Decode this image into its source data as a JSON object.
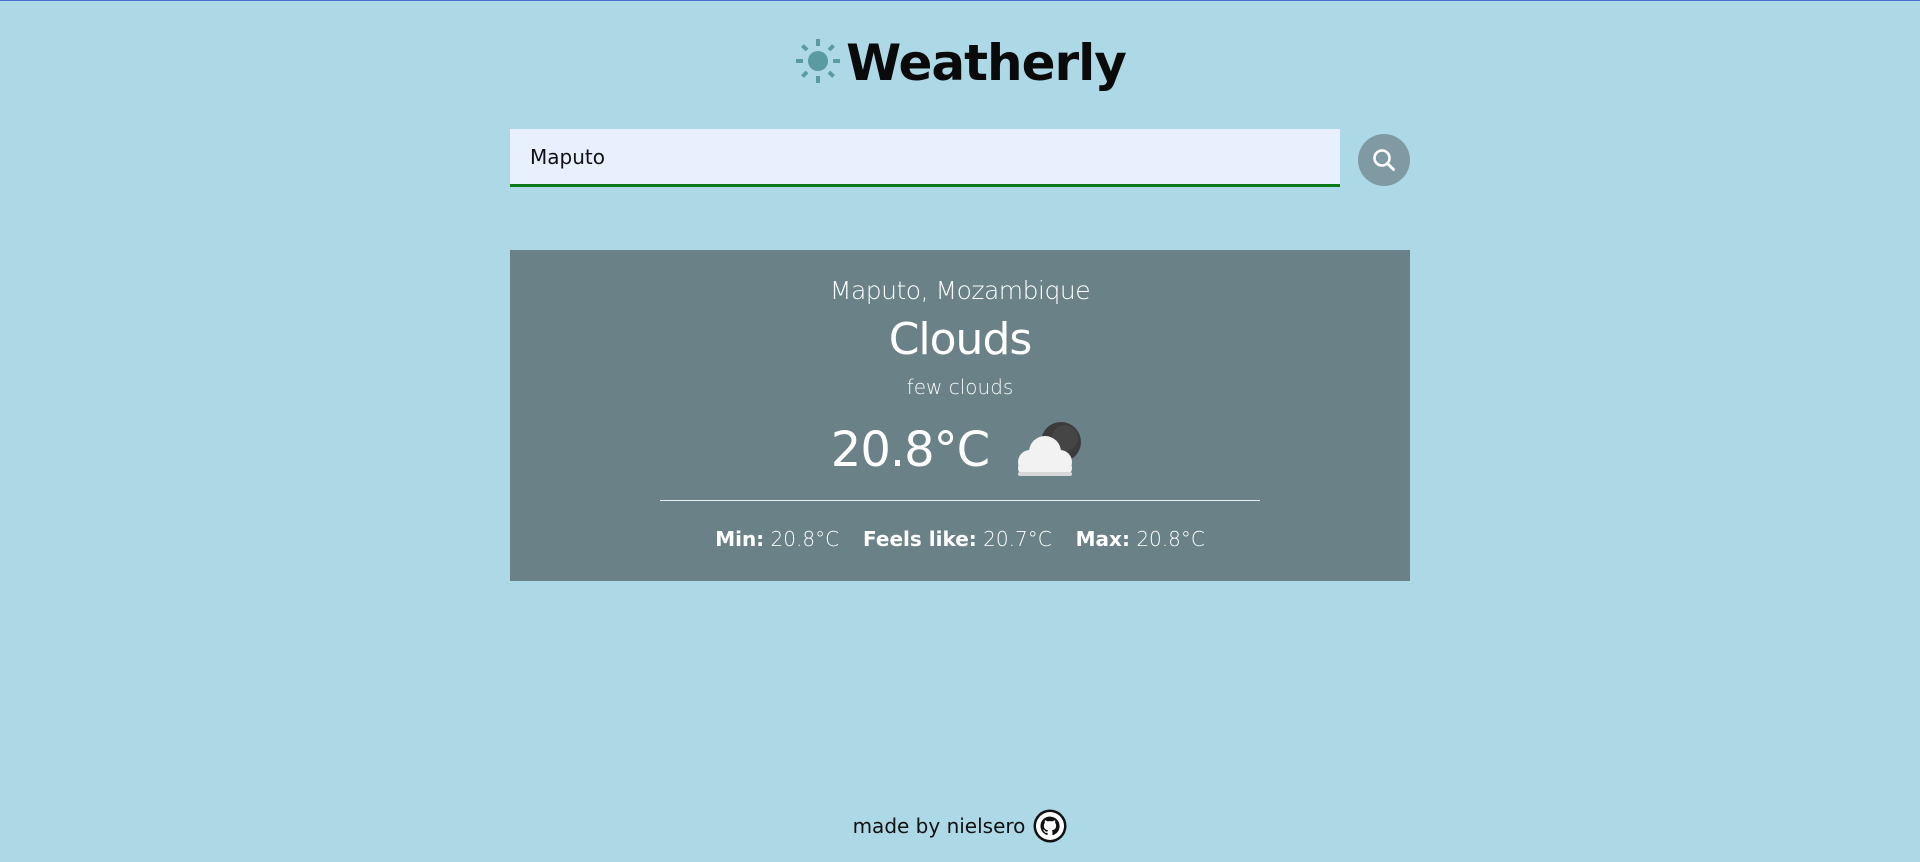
{
  "header": {
    "title": "Weatherly",
    "logo_icon": "sun-icon",
    "logo_color": "#5b9aa0"
  },
  "search": {
    "value": "Maputo",
    "button_icon": "search-icon",
    "underline_color": "#0b7a1a"
  },
  "weather": {
    "location": "Maputo, Mozambique",
    "condition": "Clouds",
    "description": "few clouds",
    "temperature": "20.8°C",
    "icon": "few-clouds-night-icon",
    "stats": {
      "min_label": "Min:",
      "min_value": "20.8°C",
      "feels_label": "Feels like:",
      "feels_value": "20.7°C",
      "max_label": "Max:",
      "max_value": "20.8°C"
    }
  },
  "footer": {
    "text": "made by nielsero",
    "link_icon": "github-icon"
  },
  "colors": {
    "background": "#add8e6",
    "card": "#6a8287",
    "search_button": "#7f9aa3"
  }
}
